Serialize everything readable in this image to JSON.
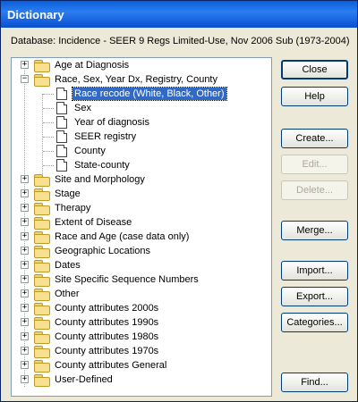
{
  "window": {
    "title": "Dictionary"
  },
  "database_line": "Database:  Incidence - SEER 9 Regs Limited-Use, Nov 2006 Sub (1973-2004)",
  "tree": {
    "items": [
      {
        "label": "Age at Diagnosis",
        "expander": "+"
      },
      {
        "label": "Race, Sex, Year Dx, Registry, County",
        "expander": "−",
        "children": [
          {
            "label": "Race recode (White, Black, Other)",
            "selected": true
          },
          {
            "label": "Sex"
          },
          {
            "label": "Year of diagnosis"
          },
          {
            "label": "SEER registry"
          },
          {
            "label": "County"
          },
          {
            "label": "State-county"
          }
        ]
      },
      {
        "label": "Site and Morphology",
        "expander": "+"
      },
      {
        "label": "Stage",
        "expander": "+"
      },
      {
        "label": "Therapy",
        "expander": "+"
      },
      {
        "label": "Extent of Disease",
        "expander": "+"
      },
      {
        "label": "Race and Age (case data only)",
        "expander": "+"
      },
      {
        "label": "Geographic Locations",
        "expander": "+"
      },
      {
        "label": "Dates",
        "expander": "+"
      },
      {
        "label": "Site Specific Sequence Numbers",
        "expander": "+"
      },
      {
        "label": "Other",
        "expander": "+"
      },
      {
        "label": "County attributes 2000s",
        "expander": "+"
      },
      {
        "label": "County attributes 1990s",
        "expander": "+"
      },
      {
        "label": "County attributes 1980s",
        "expander": "+"
      },
      {
        "label": "County attributes 1970s",
        "expander": "+"
      },
      {
        "label": "County attributes General",
        "expander": "+"
      },
      {
        "label": "User-Defined",
        "expander": "+"
      }
    ]
  },
  "buttons": {
    "close": "Close",
    "help": "Help",
    "create": "Create...",
    "edit": "Edit...",
    "delete": "Delete...",
    "merge": "Merge...",
    "import": "Import...",
    "export": "Export...",
    "categories": "Categories...",
    "find": "Find..."
  }
}
